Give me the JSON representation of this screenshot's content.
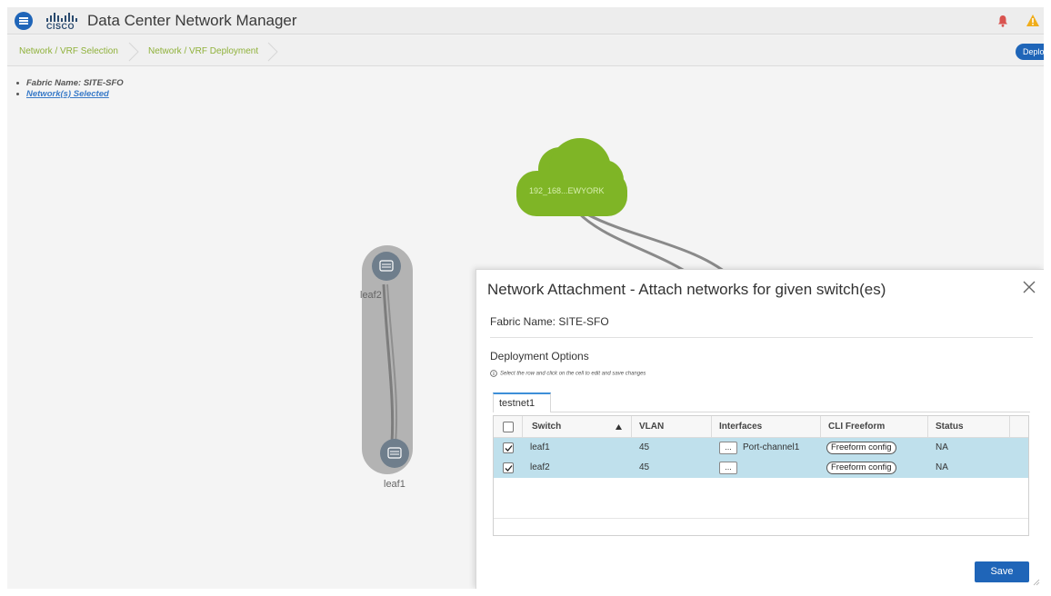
{
  "header": {
    "logo_text": "CISCO",
    "app_title": "Data Center Network Manager"
  },
  "breadcrumb": {
    "step1": "Network / VRF Selection",
    "step2": "Network / VRF Deployment"
  },
  "toolbar": {
    "deploy_label": "Deploy"
  },
  "info": {
    "fabric_name": "Fabric Name: SITE-SFO",
    "networks_selected": "Network(s) Selected"
  },
  "topology": {
    "cloud_label": "192_168...EWYORK",
    "nodes": [
      "leaf2",
      "leaf1"
    ],
    "cloud_color": "#7fb526"
  },
  "modal": {
    "title": "Network Attachment - Attach networks for given switch(es)",
    "fabric_label": "Fabric Name: SITE-SFO",
    "deployment_options": "Deployment Options",
    "hint": "Select the row and click on the cell to edit and save changes",
    "tab": "testnet1",
    "columns": [
      "Switch",
      "VLAN",
      "Interfaces",
      "CLI Freeform",
      "Status"
    ],
    "rows": [
      {
        "checked": true,
        "switch": "leaf1",
        "vlan": "45",
        "interfaces_btn": "...",
        "interfaces": "Port-channel1",
        "cli": "Freeform config",
        "status": "NA"
      },
      {
        "checked": true,
        "switch": "leaf2",
        "vlan": "45",
        "interfaces_btn": "...",
        "interfaces": "",
        "cli": "Freeform config",
        "status": "NA"
      }
    ],
    "save_label": "Save",
    "row_color": "#bfe0ec",
    "primary_color": "#1f65b8"
  },
  "icons": [
    "menu-icon",
    "cisco-logo-icon",
    "notification-icon",
    "warning-icon",
    "close-icon",
    "info-icon",
    "sort-asc-icon",
    "checkbox-icon",
    "switch-icon",
    "resize-handle-icon"
  ]
}
